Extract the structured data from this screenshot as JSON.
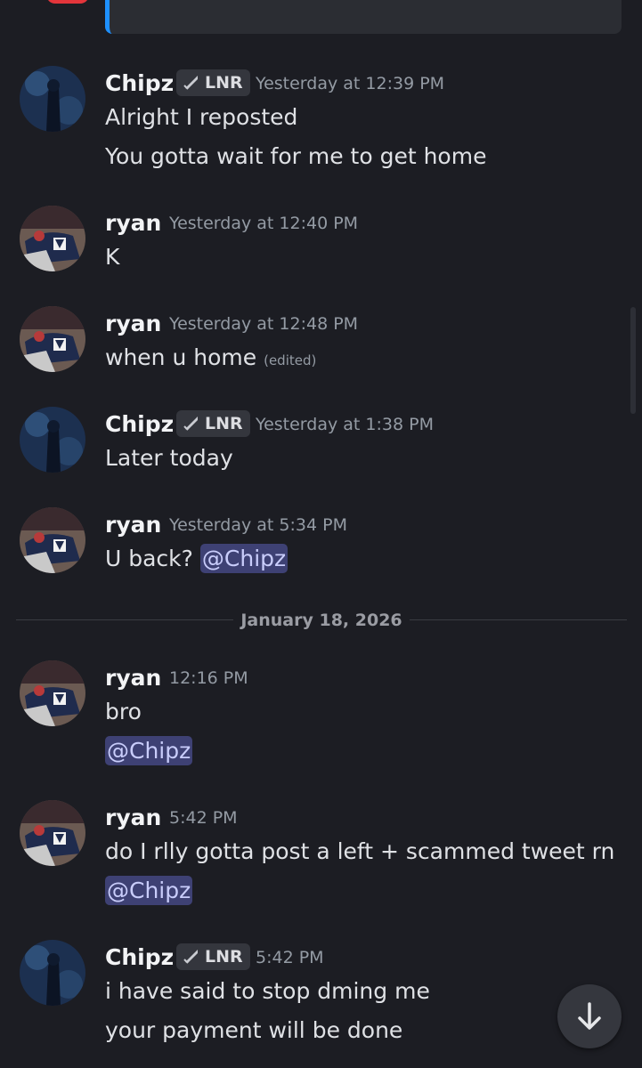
{
  "colors": {
    "background": "#1c1d23",
    "mention_bg": "#3e4174",
    "mention_text": "#c9cdfb",
    "timestamp": "#949ba4"
  },
  "date_divider": "January 18, 2026",
  "messages": [
    {
      "author": "Chipz",
      "tag": "LNR",
      "tag_icon": "sword-icon",
      "timestamp": "Yesterday at 12:39 PM",
      "lines": [
        "Alright I reposted",
        "You gotta wait for me to get home"
      ]
    },
    {
      "author": "ryan",
      "timestamp": "Yesterday at 12:40 PM",
      "lines": [
        "K"
      ]
    },
    {
      "author": "ryan",
      "timestamp": "Yesterday at 12:48 PM",
      "lines": [
        "when u home"
      ],
      "edited": "(edited)"
    },
    {
      "author": "Chipz",
      "tag": "LNR",
      "timestamp": "Yesterday at 1:38 PM",
      "lines": [
        "Later today"
      ]
    },
    {
      "author": "ryan",
      "timestamp": "Yesterday at 5:34 PM",
      "lines": [
        "U back?"
      ],
      "mention": "@Chipz"
    },
    {
      "author": "ryan",
      "timestamp": "12:16 PM",
      "lines": [
        "bro"
      ],
      "mention": "@Chipz"
    },
    {
      "author": "ryan",
      "timestamp": "5:42 PM",
      "lines": [
        "do I rlly gotta post a left + scammed tweet rn"
      ],
      "mention": "@Chipz"
    },
    {
      "author": "Chipz",
      "tag": "LNR",
      "timestamp": "5:42 PM",
      "lines": [
        "i have said to stop dming me",
        "your payment will be done"
      ]
    }
  ],
  "scroll_button_icon": "arrow-down-icon"
}
